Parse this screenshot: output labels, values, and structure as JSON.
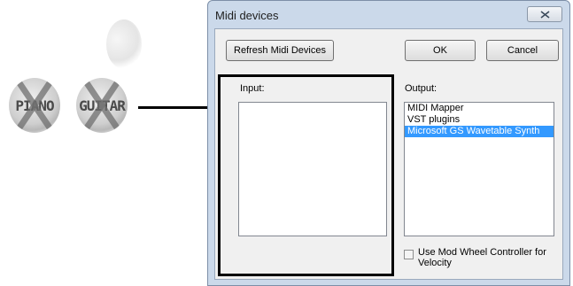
{
  "instruments": [
    {
      "label": "PIANO"
    },
    {
      "label": "GUITAR"
    }
  ],
  "dialog": {
    "title": "Midi devices",
    "buttons": {
      "refresh": "Refresh Midi Devices",
      "ok": "OK",
      "cancel": "Cancel"
    },
    "input_label": "Input:",
    "output_label": "Output:",
    "input_items": [],
    "output_items": [
      {
        "label": "MIDI Mapper",
        "selected": false
      },
      {
        "label": "VST plugins",
        "selected": false
      },
      {
        "label": "Microsoft GS Wavetable Synth",
        "selected": true
      }
    ],
    "mod_wheel": {
      "label": "Use Mod Wheel Controller for Velocity",
      "checked": false
    }
  },
  "icons": {
    "close": "close-x-icon"
  }
}
